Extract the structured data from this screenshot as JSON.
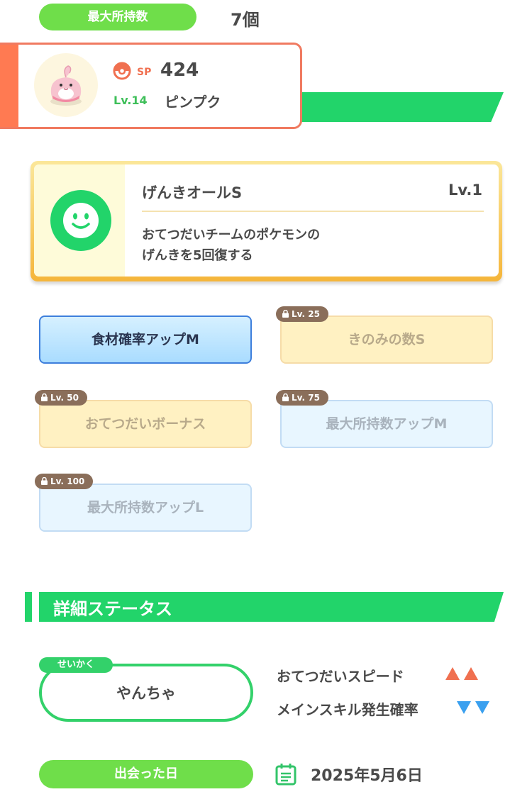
{
  "header": {
    "max_label": "最大所持数",
    "max_value": "7個"
  },
  "pokemon": {
    "sp_label": "SP",
    "sp_value": "424",
    "level": "Lv.14",
    "name": "ピンプク"
  },
  "main_skill": {
    "name": "げんきオールS",
    "level": "Lv.1",
    "description_line1": "おてつだいチームのポケモンの",
    "description_line2": "げんきを5回復する"
  },
  "sub_skills": [
    {
      "label": "食材確率アップM",
      "lock": ""
    },
    {
      "label": "きのみの数S",
      "lock": "Lv. 25"
    },
    {
      "label": "おてつだいボーナス",
      "lock": "Lv. 50"
    },
    {
      "label": "最大所持数アップM",
      "lock": "Lv. 75"
    },
    {
      "label": "最大所持数アップL",
      "lock": "Lv. 100"
    }
  ],
  "details": {
    "title": "詳細ステータス",
    "nature_tag": "せいかく",
    "nature_value": "やんちゃ",
    "stat_up": "おてつだいスピード",
    "stat_down": "メインスキル発生確率",
    "met_label": "出会った日",
    "met_date": "2025年5月6日"
  },
  "colors": {
    "accent_green": "#22d46a",
    "pill_green": "#6fde4a",
    "up_arrow": "#f07050",
    "down_arrow": "#3aa0ef"
  }
}
